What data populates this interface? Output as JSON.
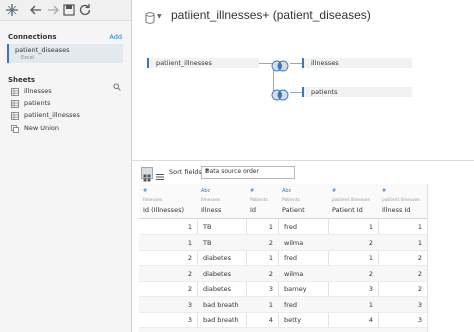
{
  "sidebar": {
    "connections_title": "Connections",
    "add_label": "Add",
    "connection": {
      "name": "patient_diseases",
      "type": "Excel"
    },
    "sheets_title": "Sheets",
    "sheets": [
      {
        "label": "illnesses",
        "icon": "sheet-table-icon"
      },
      {
        "label": "patients",
        "icon": "sheet-table-icon"
      },
      {
        "label": "patiient_illnesses",
        "icon": "sheet-table-icon"
      },
      {
        "label": "New Union",
        "icon": "new-union-icon"
      }
    ]
  },
  "header": {
    "title": "patiient_illnesses+ (patient_diseases)"
  },
  "canvas": {
    "left_table": "patiient_illnesses",
    "right_tables": [
      "illnesses",
      "patients"
    ]
  },
  "grid_toolbar": {
    "sort_label": "Sort fields",
    "sort_value": "Data source order"
  },
  "colors": {
    "accent": "#3b79b5",
    "link": "#1f77b4"
  },
  "grid": {
    "columns": [
      {
        "type": "#",
        "source": "Illnesses",
        "name": "Id (Illnesses)",
        "kind": "num"
      },
      {
        "type": "Abc",
        "source": "Illnesses",
        "name": "Illness",
        "kind": "txt"
      },
      {
        "type": "#",
        "source": "Patients",
        "name": "Id",
        "kind": "num"
      },
      {
        "type": "Abc",
        "source": "Patients",
        "name": "Patient",
        "kind": "txt"
      },
      {
        "type": "#",
        "source": "patiient illnesses",
        "name": "Patient Id",
        "kind": "num"
      },
      {
        "type": "#",
        "source": "patiient illnesses",
        "name": "Illness Id",
        "kind": "num"
      }
    ],
    "rows": [
      [
        "1",
        "TB",
        "1",
        "fred",
        "1",
        "1"
      ],
      [
        "1",
        "TB",
        "2",
        "wilma",
        "2",
        "1"
      ],
      [
        "2",
        "diabetes",
        "1",
        "fred",
        "1",
        "2"
      ],
      [
        "2",
        "diabetes",
        "2",
        "wilma",
        "2",
        "2"
      ],
      [
        "2",
        "diabetes",
        "3",
        "barney",
        "3",
        "2"
      ],
      [
        "3",
        "bad breath",
        "1",
        "fred",
        "1",
        "3"
      ],
      [
        "3",
        "bad breath",
        "4",
        "betty",
        "4",
        "3"
      ],
      [
        "",
        "",
        "",
        "",
        "",
        ""
      ]
    ]
  }
}
